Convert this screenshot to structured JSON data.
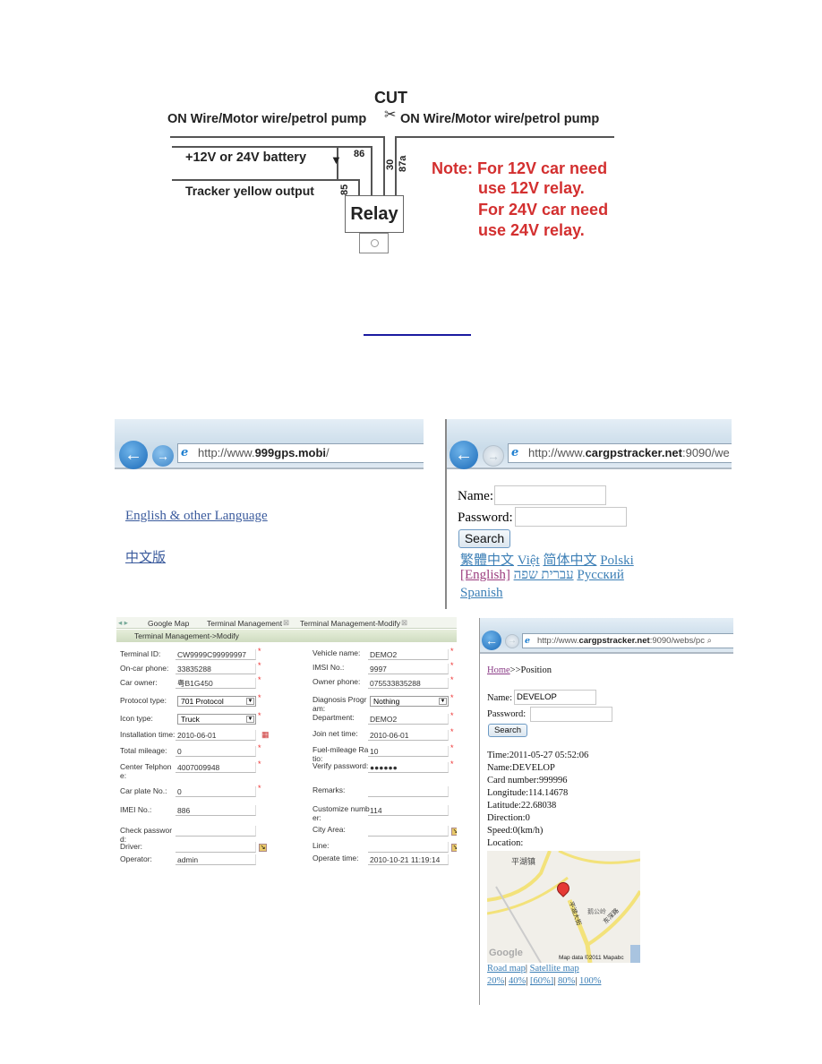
{
  "diagram": {
    "cut_label": "CUT",
    "wire_left": "ON Wire/Motor wire/petrol pump",
    "wire_right": "ON Wire/Motor wire/petrol pump",
    "battery_label": "+12V or 24V battery",
    "tracker_label": "Tracker yellow output",
    "pin_86": "86",
    "pin_85": "85",
    "pin_30": "30",
    "pin_87a": "87a",
    "relay_label": "Relay",
    "note_lines": [
      "Note: For 12V car need",
      "use 12V relay.",
      "For 24V car need",
      "use 24V relay."
    ],
    "note_color": "#d32f2f"
  },
  "browser1": {
    "url_prefix": "http://www.",
    "url_host": "999gps.mobi",
    "url_suffix": "/",
    "links": [
      "English & other Language",
      "中文版"
    ]
  },
  "browser2": {
    "url_prefix": "http://www.",
    "url_host": "cargpstracker.net",
    "url_suffix": ":9090/we",
    "name_label": "Name:",
    "password_label": "Password:",
    "search_label": "Search",
    "languages": [
      "繁體中文",
      "Việt",
      "简体中文",
      "Polski",
      "[English]",
      "עברית שפה",
      "Русский",
      "Spanish"
    ]
  },
  "terminal": {
    "tabs": [
      "Google Map",
      "Terminal Management",
      "Terminal Management-Modify"
    ],
    "header": "Terminal Management->Modify",
    "left_fields": [
      {
        "label": "Terminal ID:",
        "value": "CW9999C99999997"
      },
      {
        "label": "On-car phone:",
        "value": "33835288"
      },
      {
        "label": "Car owner:",
        "value": "粤B1G450"
      },
      {
        "label": "Protocol type:",
        "value": "701 Protocol"
      },
      {
        "label": "Icon type:",
        "value": "Truck"
      },
      {
        "label": "Installation time:",
        "value": "2010-06-01"
      },
      {
        "label": "Total mileage:",
        "value": "0"
      },
      {
        "label": "Center Telphon e:",
        "value": "4007009948"
      },
      {
        "label": "Car plate No.:",
        "value": "0"
      },
      {
        "label": "IMEI No.:",
        "value": "886"
      },
      {
        "label": "Check passwor d:",
        "value": ""
      },
      {
        "label": "Driver:",
        "value": ""
      },
      {
        "label": "Operator:",
        "value": "admin"
      }
    ],
    "right_fields": [
      {
        "label": "Vehicle name:",
        "value": "DEMO2"
      },
      {
        "label": "IMSI No.:",
        "value": "9997"
      },
      {
        "label": "Owner phone:",
        "value": "075533835288"
      },
      {
        "label": "Diagnosis Progr am:",
        "value": "Nothing"
      },
      {
        "label": "Department:",
        "value": "DEMO2"
      },
      {
        "label": "Join net time:",
        "value": "2010-06-01"
      },
      {
        "label": "Fuel-mileage Ra tio:",
        "value": "10"
      },
      {
        "label": "Verify password:",
        "value": "●●●●●●"
      },
      {
        "label": "Remarks:",
        "value": ""
      },
      {
        "label": "Customize numb er:",
        "value": "114"
      },
      {
        "label": "City Area:",
        "value": ""
      },
      {
        "label": "Line:",
        "value": ""
      },
      {
        "label": "Operate time:",
        "value": "2010-10-21 11:19:14"
      }
    ]
  },
  "position": {
    "url_prefix": "http://www.",
    "url_host": "cargpstracker.net",
    "url_suffix": ":9090/webs/pc",
    "breadcrumb_home": "Home",
    "breadcrumb_rest": ">>Position",
    "name_label": "Name:",
    "name_value": "DEVELOP",
    "password_label": "Password:",
    "search_label": "Search",
    "info_lines": [
      "Time:2011-05-27 05:52:06",
      "Name:DEVELOP",
      "Card number:999996",
      "Longitude:114.14678",
      "Latitude:22.68038",
      "Direction:0",
      "Speed:0(km/h)",
      "Location:"
    ],
    "map_labels": [
      "平湖镇",
      "鹅公岭",
      "平湖大街",
      "东深路"
    ],
    "map_attribution": "Map data ©2011 Mapabc",
    "map_logo": "Google",
    "map_types": [
      "Road map",
      "Satellite map"
    ],
    "zoom_levels": [
      "20%",
      "40%",
      "[60%]",
      "80%",
      "100%"
    ]
  }
}
